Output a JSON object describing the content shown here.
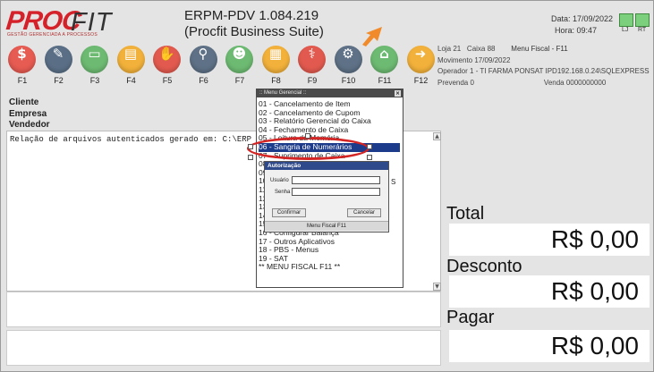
{
  "app": {
    "logo_pro": "PROC",
    "logo_fit": "FIT",
    "logo_tagline": "GESTÃO GERENCIADA A PROCESSOS",
    "title_line1": "ERPM-PDV 1.084.219",
    "title_line2": "(Procfit Business Suite)",
    "date_label": "Data: 17/09/2022",
    "time_label": "Hora: 09:47",
    "light_left_label": "LJ",
    "light_right_label": "RT"
  },
  "toolbar": {
    "keys": [
      {
        "label": "F1",
        "color": "#e65b52",
        "icon": "money-icon",
        "glyph": "$"
      },
      {
        "label": "F2",
        "color": "#5a6f86",
        "icon": "edit-icon",
        "glyph": "✎"
      },
      {
        "label": "F3",
        "color": "#6dba72",
        "icon": "card-icon",
        "glyph": "▭"
      },
      {
        "label": "F4",
        "color": "#f2b13a",
        "icon": "id-card-icon",
        "glyph": "▤"
      },
      {
        "label": "F5",
        "color": "#e25a4f",
        "icon": "hand-icon",
        "glyph": "✋"
      },
      {
        "label": "F6",
        "color": "#5e7186",
        "icon": "search-icon",
        "glyph": "⚲"
      },
      {
        "label": "F7",
        "color": "#6dba72",
        "icon": "users-icon",
        "glyph": "☻"
      },
      {
        "label": "F8",
        "color": "#f2b13a",
        "icon": "calculator-icon",
        "glyph": "▦"
      },
      {
        "label": "F9",
        "color": "#e25a4f",
        "icon": "medical-icon",
        "glyph": "⚕"
      },
      {
        "label": "F10",
        "color": "#5e7186",
        "icon": "gears-icon",
        "glyph": "⚙"
      },
      {
        "label": "F11",
        "color": "#6dba72",
        "icon": "bank-icon",
        "glyph": "⌂"
      },
      {
        "label": "F12",
        "color": "#f2b13a",
        "icon": "arrow-right-icon",
        "glyph": "➜"
      }
    ]
  },
  "info": {
    "loja": "Loja  21",
    "caixa": "Caixa  88",
    "menu_fiscal": "Menu Fiscal - F11",
    "movimento": "Movimento  17/09/2022",
    "operador": "Operador   1 - TI FARMA PONSAT IPD192.168.0.24\\SQLEXPRESS",
    "prevenda": "Prevenda  0",
    "venda": "Venda   0000000000"
  },
  "customer": {
    "cliente": "Cliente",
    "empresa": "Empresa",
    "vendedor": "Vendedor"
  },
  "log": {
    "line": "Relação de arquivos autenticados gerado em: C:\\ERP"
  },
  "menu": {
    "title": ":: Menu Gerencial ::",
    "items": [
      "01 - Cancelamento de Item",
      "02 - Cancelamento de Cupom",
      "03 - Relatório Gerencial do Caixa",
      "04 - Fechamento de Caixa",
      "05 - Leitura da Memória",
      "06 - Sangria de Numerários",
      "07 - Suprimento de Caixa",
      "08",
      "09",
      "10",
      "11",
      "12",
      "13",
      "14",
      "15",
      "16 - Configurar Balança",
      "17 - Outros Aplicativos",
      "18 - PBS - Menus",
      "19 - SAT",
      "** MENU FISCAL F11 **"
    ],
    "selected_index": 5
  },
  "auth": {
    "title": "Autorização",
    "user_label": "Usuário",
    "pass_label": "Senha",
    "confirm": "Confirmar",
    "cancel": "Cancelar",
    "footer": "Menu Fiscal F11",
    "partial_text": "S"
  },
  "totals": {
    "total_label": "Total",
    "total_value": "R$ 0,00",
    "desconto_label": "Desconto",
    "desconto_value": "R$ 0,00",
    "pagar_label": "Pagar",
    "pagar_value": "R$ 0,00"
  },
  "colors": {
    "accent_red": "#d42424",
    "selection_blue": "#1c3b8a",
    "arrow_orange": "#f08a2a"
  }
}
